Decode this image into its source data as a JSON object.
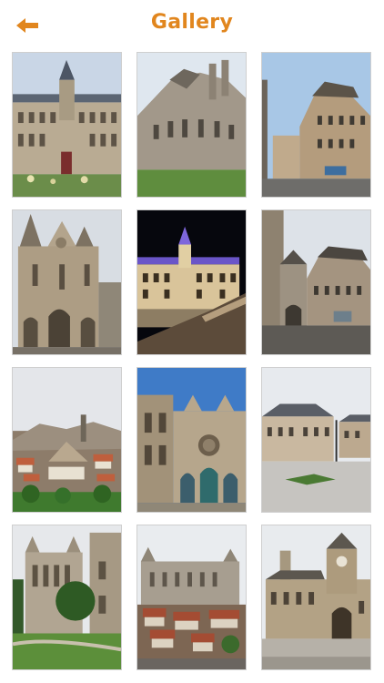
{
  "header": {
    "title": "Gallery",
    "back_icon": "arrow-left-icon",
    "accent_color": "#e1861e"
  },
  "gallery": {
    "photos": [
      {
        "subject": "town-hall"
      },
      {
        "subject": "church-apse"
      },
      {
        "subject": "timbered-houses-square"
      },
      {
        "subject": "romanesque-church-facade"
      },
      {
        "subject": "town-hall-night"
      },
      {
        "subject": "old-town-square"
      },
      {
        "subject": "city-rooftops-view"
      },
      {
        "subject": "gothic-cathedral-facade"
      },
      {
        "subject": "classical-building-plaza"
      },
      {
        "subject": "ruined-abbey"
      },
      {
        "subject": "cathedral-over-town"
      },
      {
        "subject": "chateau-clock-tower"
      }
    ]
  }
}
